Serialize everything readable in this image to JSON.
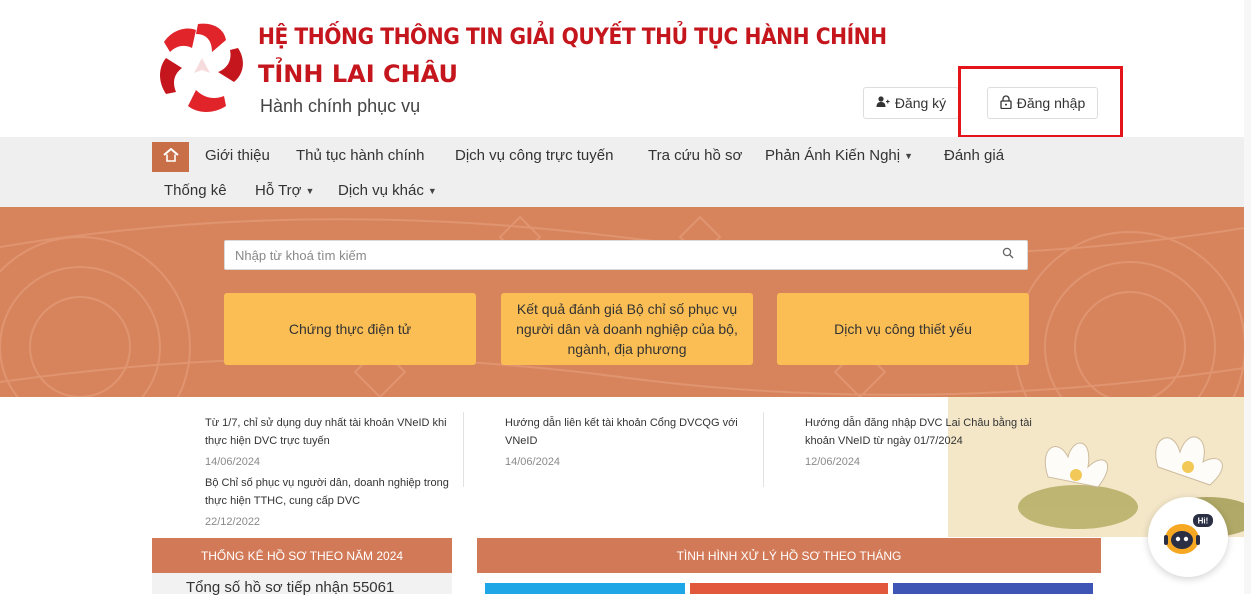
{
  "header": {
    "title": "HỆ THỐNG THÔNG TIN GIẢI QUYẾT THỦ TỤC HÀNH CHÍNH",
    "province": "TỈNH LAI CHÂU",
    "slogan": "Hành chính phục vụ",
    "register_label": "Đăng ký",
    "login_label": "Đăng nhập"
  },
  "nav": {
    "items": [
      {
        "label": "Giới thiệu",
        "dropdown": false
      },
      {
        "label": "Thủ tục hành chính",
        "dropdown": false
      },
      {
        "label": "Dịch vụ công trực tuyến",
        "dropdown": false
      },
      {
        "label": "Tra cứu hồ sơ",
        "dropdown": false
      },
      {
        "label": "Phản Ánh Kiến Nghị",
        "dropdown": true
      },
      {
        "label": "Đánh giá",
        "dropdown": false
      },
      {
        "label": "Thống kê",
        "dropdown": false
      },
      {
        "label": "Hỗ Trợ",
        "dropdown": true
      },
      {
        "label": "Dịch vụ khác",
        "dropdown": true
      }
    ]
  },
  "search": {
    "placeholder": "Nhập từ khoá tìm kiếm"
  },
  "tiles": [
    {
      "label": "Chứng thực điện tử"
    },
    {
      "label": "Kết quả đánh giá Bộ chỉ số phục vụ người dân và doanh nghiệp của bộ, ngành, địa phương"
    },
    {
      "label": "Dịch vụ công thiết yếu"
    }
  ],
  "news": [
    {
      "title": "Từ 1/7, chỉ sử dụng duy nhất tài khoản VNeID khi thực hiện DVC trực tuyến",
      "date": "14/06/2024"
    },
    {
      "title": "Hướng dẫn liên kết tài khoản Cổng DVCQG với VNeID",
      "date": "14/06/2024"
    },
    {
      "title": "Hướng dẫn đăng nhập DVC Lai Châu bằng tài khoản VNeID từ ngày 01/7/2024",
      "date": "12/06/2024"
    },
    {
      "title": "Bộ Chỉ số phục vụ người dân, doanh nghiệp trong thực hiện TTHC, cung cấp DVC",
      "date": "22/12/2022"
    }
  ],
  "panels": {
    "left_title": "THỐNG KÊ HỒ SƠ THEO NĂM 2024",
    "right_title": "TÌNH HÌNH XỬ LÝ HỒ SƠ THEO THÁNG",
    "total_text": "Tổng số hồ sơ tiếp nhận 55061"
  },
  "chatbot": {
    "badge": "Hi!"
  },
  "colors": {
    "brand_red": "#c4161c",
    "accent_orange": "#d27a58",
    "tile_yellow": "#fbbe54",
    "highlight_red": "#e4141b"
  }
}
